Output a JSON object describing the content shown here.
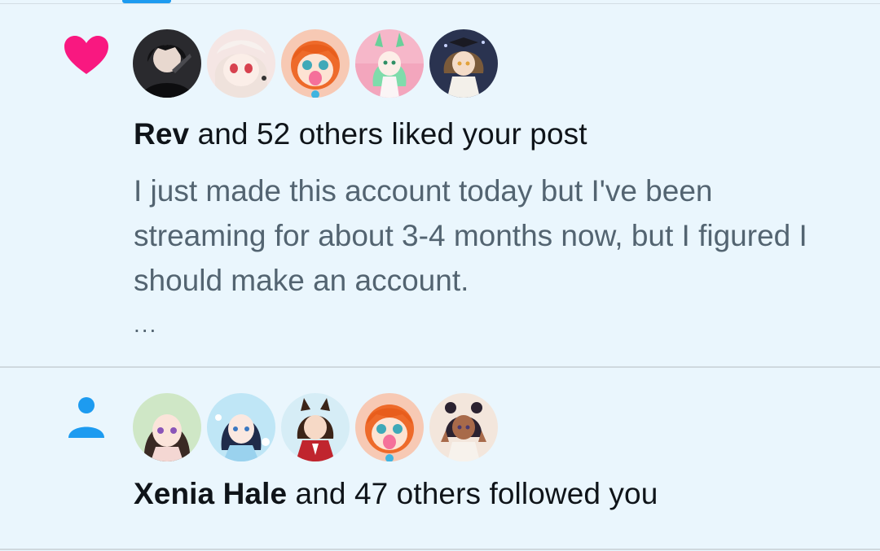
{
  "colors": {
    "background": "#eaf6fd",
    "like_icon": "#f91880",
    "follow_icon": "#1d9bf0",
    "secondary_text": "#536471",
    "primary_text": "#0f1419"
  },
  "notifications": [
    {
      "type": "like",
      "icon": "heart-icon",
      "actor": "Rev",
      "action_text": " and 52 others liked your post",
      "preview": "I just made this account today but I've been streaming for about 3-4 months now, but I figured I should make an account.",
      "more": "..."
    },
    {
      "type": "follow",
      "icon": "person-icon",
      "actor": "Xenia Hale",
      "action_text": " and 47 others followed you"
    }
  ]
}
